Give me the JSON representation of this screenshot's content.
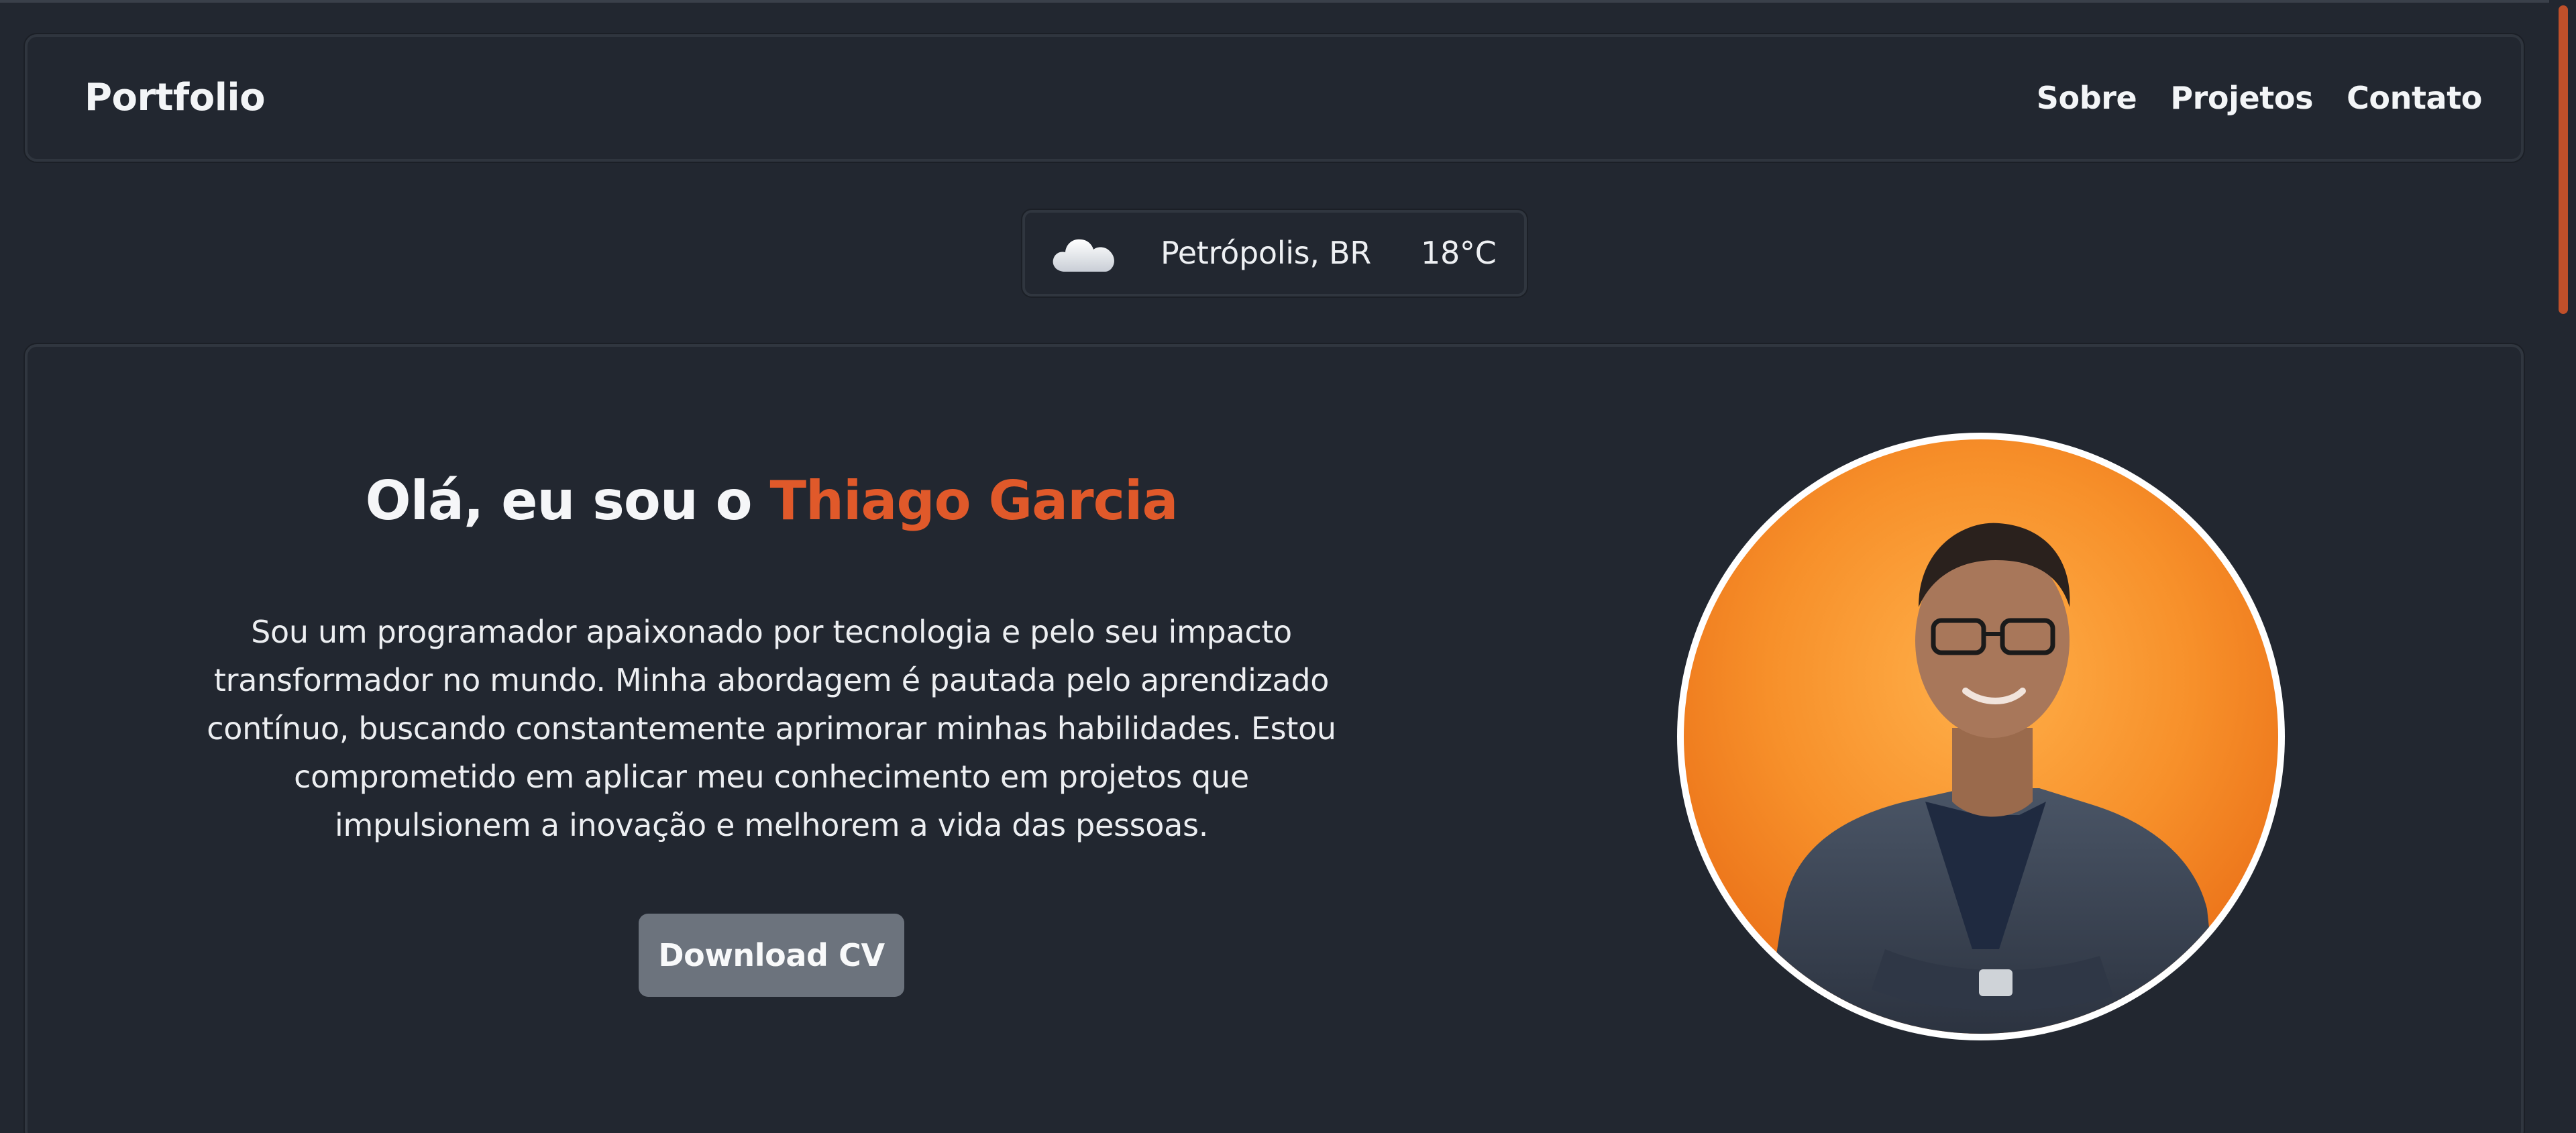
{
  "navbar": {
    "brand": "Portfolio",
    "links": [
      {
        "label": "Sobre"
      },
      {
        "label": "Projetos"
      },
      {
        "label": "Contato"
      }
    ]
  },
  "weather": {
    "icon": "cloud-icon",
    "city": "Petrópolis, BR",
    "temperature": "18°C"
  },
  "hero": {
    "greeting": "Olá, eu sou o",
    "name": "Thiago Garcia",
    "description": "Sou um programador apaixonado por tecnologia e pelo seu impacto transformador no mundo. Minha abordagem é pautada pelo aprendizado contínuo, buscando constantemente aprimorar minhas habilidades. Estou comprometido em aplicar meu conhecimento em projetos que impulsionem a inovação e melhorem a vida das pessoas.",
    "cv_button": "Download CV"
  },
  "colors": {
    "background": "#222730",
    "accent": "#e0592a",
    "button": "#6c737d",
    "scroll_thumb": "#c0502a"
  }
}
